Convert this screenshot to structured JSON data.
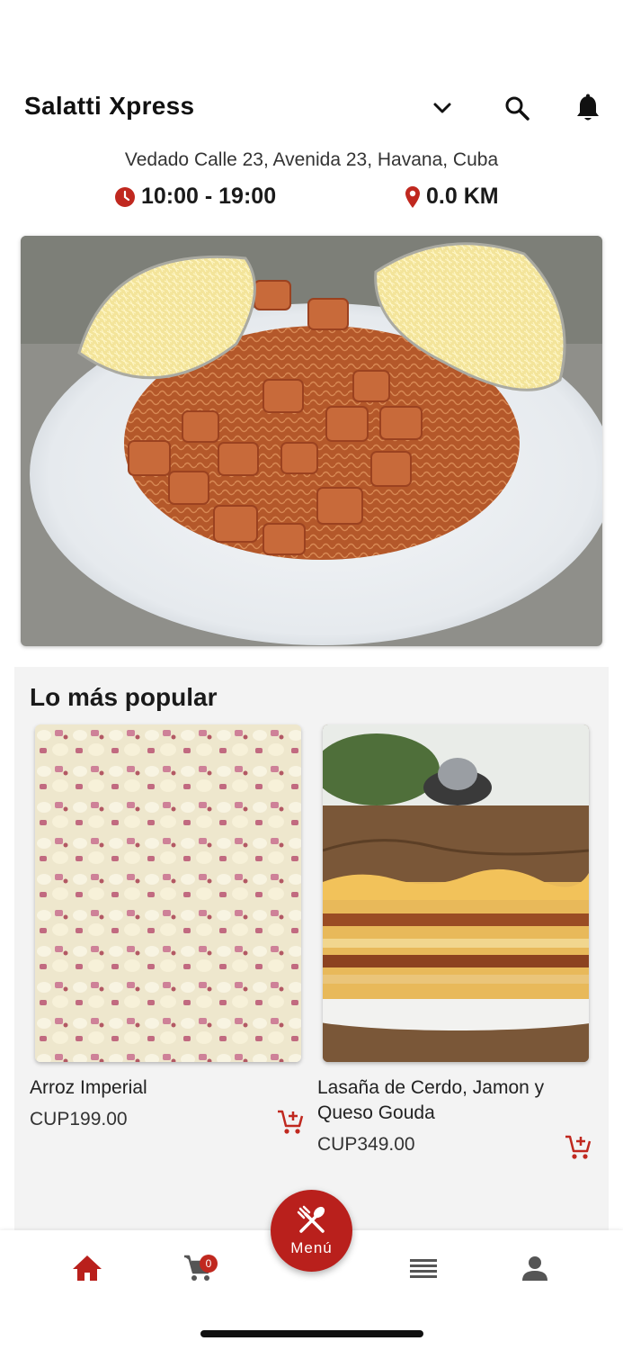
{
  "header": {
    "title": "Salatti Xpress",
    "icons": [
      "chevron-down-icon",
      "search-icon",
      "bell-icon"
    ]
  },
  "store": {
    "address": "Vedado Calle 23, Avenida 23, Havana, Cuba",
    "hours": "10:00 - 19:00",
    "distance": "0.0 KM",
    "icons": [
      "clock-icon",
      "location-pin-icon"
    ]
  },
  "hero": {
    "image": "spaghetti-with-chicken-and-cheese"
  },
  "popular": {
    "title": "Lo más popular",
    "items": [
      {
        "name": "Arroz Imperial",
        "price": "CUP199.00",
        "image": "arroz-imperial-photo"
      },
      {
        "name": "Lasaña de Cerdo, Jamon y Queso Gouda",
        "price": "CUP349.00",
        "image": "lasagna-photo"
      }
    ]
  },
  "nav": {
    "cart_count": "0",
    "menu_label": "Menú",
    "items": [
      "home-icon",
      "cart-icon",
      "menu-icon",
      "list-icon",
      "profile-icon"
    ]
  },
  "colors": {
    "accent": "#b9201c",
    "background": "#ffffff",
    "section_bg": "#f3f3f3"
  }
}
